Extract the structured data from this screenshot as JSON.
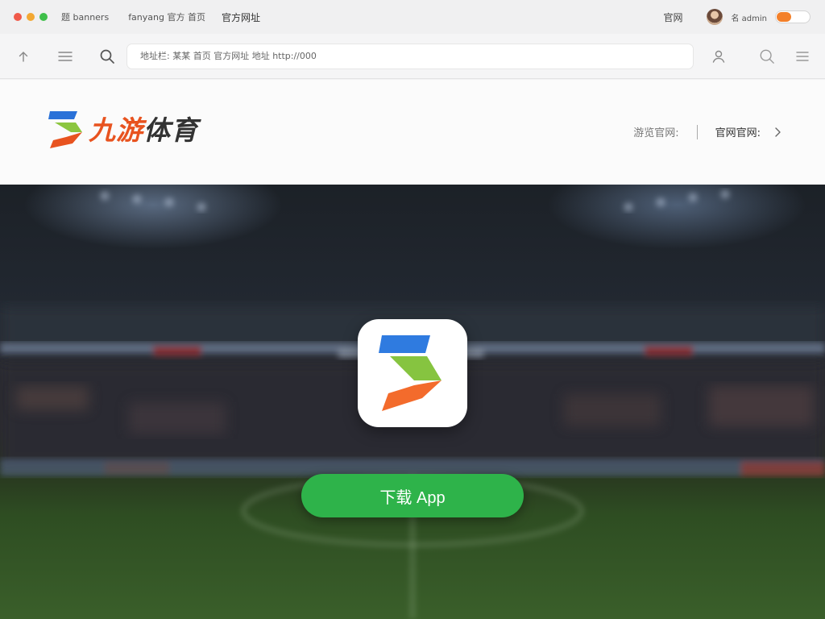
{
  "window": {
    "controls": [
      {
        "name": "close",
        "color": "#f05a4a"
      },
      {
        "name": "minimize",
        "color": "#f3a833"
      },
      {
        "name": "maximize",
        "color": "#3fbf4a"
      }
    ],
    "tabs": [
      "题 banners",
      "fanyang 官方 首页",
      "官方网址"
    ],
    "right_link": "官网",
    "user_name": "名 admin",
    "toggle_on": true,
    "accent": "#f3802a"
  },
  "toolbar": {
    "address_text": "地址栏: 某某 首页 官方网址 地址 http://000",
    "icons": [
      "upload-icon",
      "menu-icon",
      "search-icon",
      "user-icon",
      "search-icon",
      "list-icon"
    ]
  },
  "header": {
    "logo_text_colored": "九游",
    "logo_text_dark": "体育",
    "link_backup": "游览官网:",
    "link_official": "官网官网:"
  },
  "hero": {
    "download_label": "下载 App",
    "button_color": "#2eb34a"
  }
}
